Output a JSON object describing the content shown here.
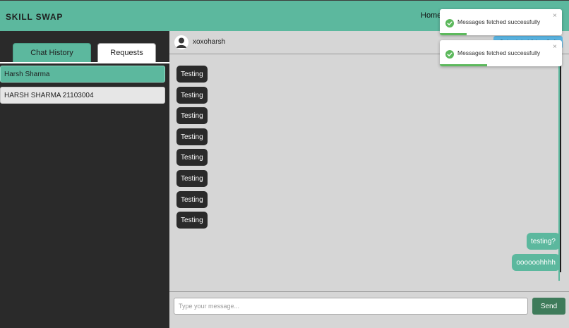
{
  "app": {
    "brand": "SKILL SWAP",
    "nav_home": "Home"
  },
  "sidebar": {
    "tabs": [
      {
        "label": "Chat History",
        "active": true
      },
      {
        "label": "Requests",
        "active": false
      }
    ],
    "chats": [
      {
        "name": "Harsh Sharma",
        "selected": true
      },
      {
        "name": "HARSH SHARMA 21103004",
        "selected": false
      }
    ]
  },
  "chat": {
    "username": "xoxoharsh",
    "schedule_button": "Schedule Video Call",
    "messages_in": [
      "Testing",
      "Testing",
      "Testing",
      "Testing",
      "Testing",
      "Testing",
      "Testing",
      "Testing"
    ],
    "messages_out": [
      "testing?",
      "oooooohhhh"
    ],
    "input_placeholder": "Type your message...",
    "input_value": "",
    "send_label": "Send"
  },
  "toasts": [
    {
      "text": "Messages fetched successfully",
      "close": "×",
      "icon": "check-circle-icon",
      "progress": 0.22
    },
    {
      "text": "Messages fetched successfully",
      "close": "×",
      "icon": "check-circle-icon",
      "progress": 0.39
    }
  ],
  "colors": {
    "accent": "#5cb89e",
    "dark": "#2a2a2a",
    "chat_bg": "#d6d6d6",
    "send": "#3e7b5a",
    "success": "#5cb85c",
    "schedule": "#5bb7e6"
  }
}
